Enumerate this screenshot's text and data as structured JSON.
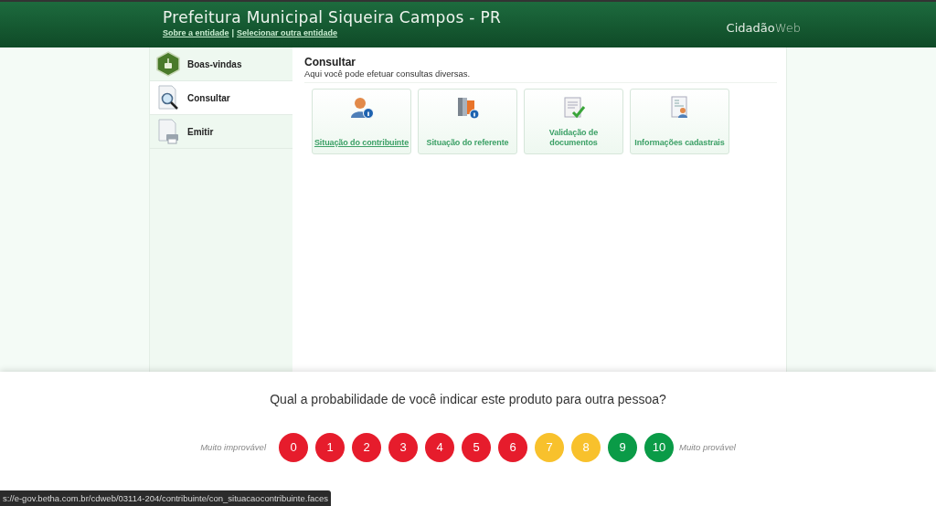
{
  "header": {
    "title": "Prefeitura Municipal Siqueira Campos - PR",
    "links": [
      "Sobre a entidade",
      "Selecionar outra entidade"
    ],
    "separator": "|",
    "brand": {
      "bold": "Cidadão",
      "light": "Web"
    }
  },
  "sidebar": {
    "items": [
      {
        "label": "Boas-vindas",
        "kind": "welcome",
        "selected": false
      },
      {
        "label": "Consultar",
        "kind": "search",
        "selected": true
      },
      {
        "label": "Emitir",
        "kind": "print",
        "selected": false
      }
    ]
  },
  "content": {
    "title": "Consultar",
    "subtitle": "Aqui você pode efetuar consultas diversas.",
    "cards": [
      {
        "label": "Situação do contribuinte",
        "kind": "person",
        "hovered": true
      },
      {
        "label": "Situação do referente",
        "kind": "books",
        "hovered": false
      },
      {
        "label": "Validação de documentos",
        "kind": "document",
        "hovered": false
      },
      {
        "label": "Informações cadastrais",
        "kind": "record",
        "hovered": false
      }
    ]
  },
  "survey": {
    "question": "Qual a probabilidade de você indicar este produto para outra pessoa?",
    "low_label": "Muito improvável",
    "high_label": "Muito provável",
    "scores": [
      {
        "label": "0",
        "color": "#e61c2c"
      },
      {
        "label": "1",
        "color": "#e61c2c"
      },
      {
        "label": "2",
        "color": "#e61c2c"
      },
      {
        "label": "3",
        "color": "#e61c2c"
      },
      {
        "label": "4",
        "color": "#e61c2c"
      },
      {
        "label": "5",
        "color": "#e61c2c"
      },
      {
        "label": "6",
        "color": "#e61c2c"
      },
      {
        "label": "7",
        "color": "#f8c12c"
      },
      {
        "label": "8",
        "color": "#f8c12c"
      },
      {
        "label": "9",
        "color": "#0a9b47"
      },
      {
        "label": "10",
        "color": "#0a9b47"
      }
    ]
  },
  "status_bar": {
    "url": "s://e-gov.betha.com.br/cdweb/03114-204/contribuinte/con_situacaocontribuinte.faces"
  }
}
